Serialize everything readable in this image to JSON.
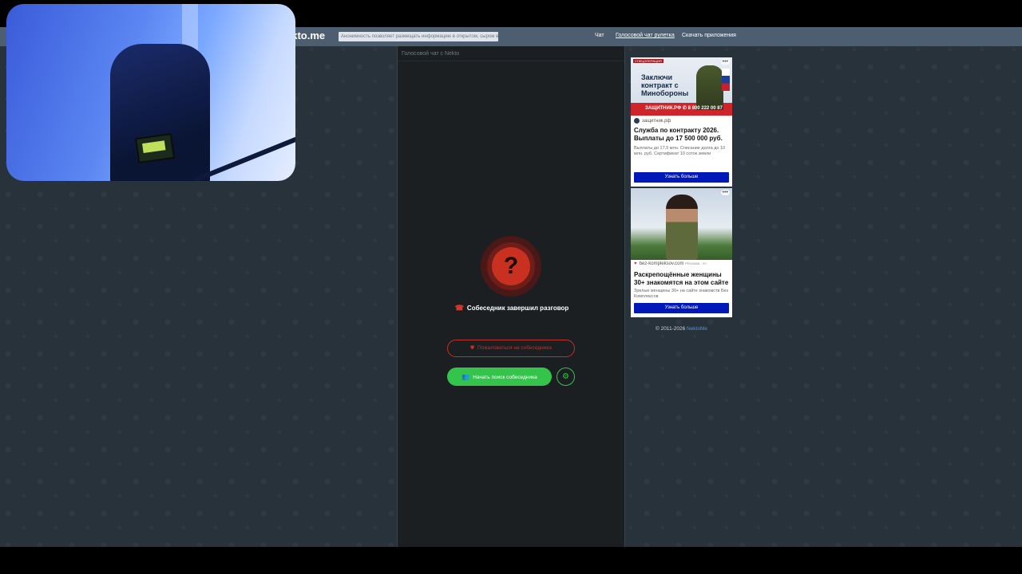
{
  "header": {
    "logo": "ekto.me",
    "notice": "Анонимность позволяет размещать информацию в открытом, сыром виде",
    "nav": [
      "Чат",
      "Голосовой чат рулетка",
      "Скачать приложения"
    ]
  },
  "chat": {
    "title": "Голосовой чат с Nekto",
    "status_symbol": "?",
    "status_text": "Собеседник завершил разговор",
    "complain_label": "Пожаловаться на собеседника",
    "start_label": "Начать поиск собеседника"
  },
  "ads": [
    {
      "badge": "СПЕЦОПЕРАЦИЯ",
      "image_headline": "Заключи контракт с Минобороны",
      "image_footer": "ЗАЩИТНИК.РФ ✆ 8 800 222 00 87",
      "domain": "защитник.рф",
      "title": "Служба по контракту 2026. Выплаты до 17 500 000 руб.",
      "desc": "Выплаты до 17,5 млн. Списание долга до 10 млн. руб. Сертификат 10 соток земли",
      "button": "Узнать больше"
    },
    {
      "domain": "bez-kompleksov.com",
      "domain_tag": "Реклама · 6+",
      "title": "Раскрепощённые женщины 30+ знакомятся на этом сайте",
      "desc": "Зрелые женщины 30+ на сайте знакомств Без Комплексов",
      "button": "Узнать больше"
    }
  ],
  "footer": {
    "copyright": "© 2011-2026",
    "brand": "NektoMe"
  },
  "colors": {
    "header_bg": "#4c5e70",
    "page_bg": "#28323b",
    "panel_bg": "#1b1f22",
    "danger": "#c2302a",
    "success": "#35c44b",
    "ad_button": "#0018b8"
  }
}
